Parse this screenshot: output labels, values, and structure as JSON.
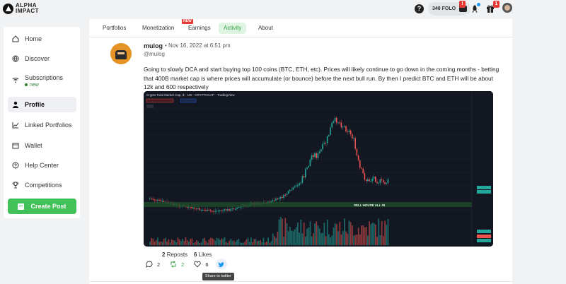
{
  "brand": {
    "line1": "ALPHA",
    "line2": "IMPACT"
  },
  "topbar": {
    "help_icon": "question-circle-icon",
    "folo_balance": "348 FOLO",
    "wallet_badge": "!",
    "gift_badge": "1"
  },
  "sidebar": {
    "items": [
      {
        "label": "Home",
        "icon": "home-icon"
      },
      {
        "label": "Discover",
        "icon": "globe-icon"
      },
      {
        "label": "Subscriptions",
        "icon": "wifi-icon",
        "sub": "new"
      },
      {
        "label": "Profile",
        "icon": "user-icon",
        "active": true
      },
      {
        "label": "Linked Portfolios",
        "icon": "chart-line-icon"
      },
      {
        "label": "Wallet",
        "icon": "wallet-icon"
      },
      {
        "label": "Help Center",
        "icon": "question-icon"
      },
      {
        "label": "Competitions",
        "icon": "trophy-icon"
      }
    ],
    "create_post": "Create Post"
  },
  "tabs": {
    "items": [
      "Portfolios",
      "Monetization",
      "Earnings",
      "Activity",
      "About"
    ],
    "active": "Activity",
    "new_badge": "NEW"
  },
  "post": {
    "author": "mulog",
    "date": "• Nov 16, 2022 at 6:51 pm",
    "handle": "@mulog",
    "text": "Going to slowly DCA and start buying top 100 coins (BTC, ETH, etc). Prices will likely continue to go down in the coming months - betting that 400B market cap is where prices will accumulate (or bounce) before the next bull run. By then I predict BTC and ETH will be about 12k and 600 respectively",
    "chart": {
      "title": "Crypto Total Market Cap, $ · 1W · CRYPTOCAP · TradingView",
      "annotation": "SELL HOUSE ALL IN",
      "colors": {
        "up": "#26a69a",
        "down": "#ef5350",
        "bg": "#131722"
      }
    },
    "reposts_count": "2",
    "reposts_label": "Reposts",
    "likes_count": "6",
    "likes_label": "Likes",
    "actions": {
      "comments": "2",
      "reposts": "2",
      "likes": "6"
    },
    "tooltip": "Share to twitter"
  }
}
